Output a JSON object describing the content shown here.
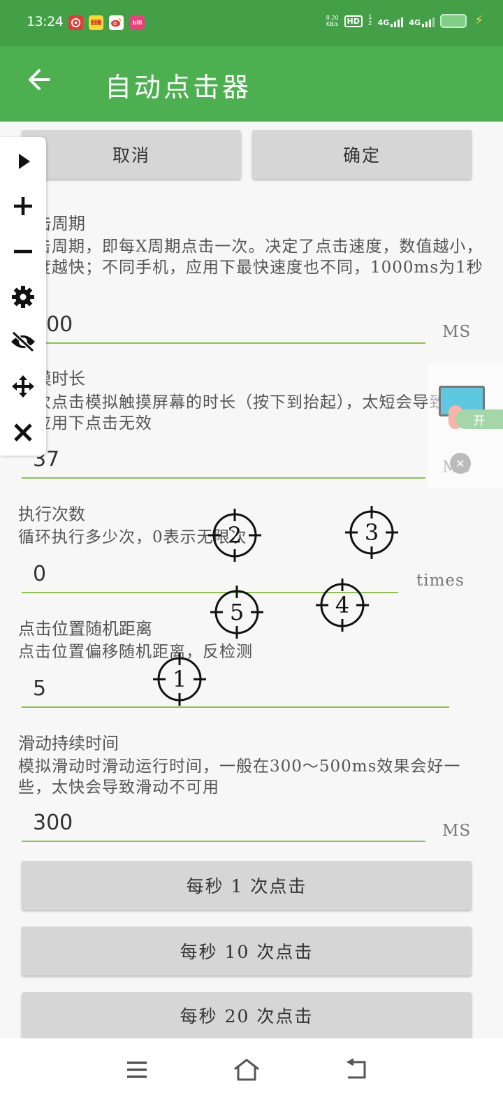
{
  "status_bar": {
    "time": "13:24",
    "apps": [
      {
        "icon": "netease-music-icon",
        "color": "#e53935",
        "text": ""
      },
      {
        "icon": "news-app-icon",
        "color": "#fdd835",
        "text": "朋圈"
      },
      {
        "icon": "weibo-icon",
        "color": "#ffffff",
        "text": ""
      },
      {
        "icon": "video-app-icon",
        "color": "#ec407a",
        "text": "bili"
      }
    ],
    "net_speed": "8.20",
    "net_unit": "KB/s",
    "hd": "HD",
    "sim1": "1",
    "sim2": "2",
    "signal1_label": "4G",
    "signal2_label": "4G"
  },
  "app_bar": {
    "title": "自动点击器",
    "back_icon": "arrow-left-icon"
  },
  "actions": {
    "cancel": "取消",
    "confirm": "确定"
  },
  "settings": [
    {
      "label": "点击周期",
      "desc": "点击周期，即每X周期点击一次。决定了点击速度，数值越小，速度越快；不同手机，应用下最快速度也不同，1000ms为1秒",
      "value": "500",
      "unit": "MS"
    },
    {
      "label": "触摸时长",
      "desc": "每次点击模拟触摸屏幕的时长（按下到抬起），太短会导致部分应用下点击无效",
      "value": "37",
      "unit": "MS"
    },
    {
      "label": "执行次数",
      "desc": "循环执行多少次，0表示无限次",
      "value": "0",
      "unit": "times"
    },
    {
      "label": "点击位置随机距离",
      "desc": "点击位置偏移随机距离，反检测",
      "value": "5",
      "unit": ""
    },
    {
      "label": "滑动持续时间",
      "desc": "模拟滑动时滑动运行时间，一般在300～500ms效果会好一些，太快会导致滑动不可用",
      "value": "300",
      "unit": "MS"
    }
  ],
  "presets": [
    "每秒 1 次点击",
    "每秒 10 次点击",
    "每秒 20 次点击"
  ],
  "targets": [
    "1",
    "2",
    "3",
    "4",
    "5"
  ],
  "widget": {
    "toggle_label": "开"
  },
  "float_toolbar": [
    "play-icon",
    "plus-icon",
    "minus-icon",
    "settings-icon",
    "hide-icon",
    "move-icon",
    "close-icon"
  ],
  "nav_bar": [
    "menu-icon",
    "home-icon",
    "back-icon"
  ],
  "colors": {
    "status_bar": "#43a047",
    "app_bar": "#4caf50",
    "underline": "#8bc34a",
    "button": "#d6d6d6"
  }
}
